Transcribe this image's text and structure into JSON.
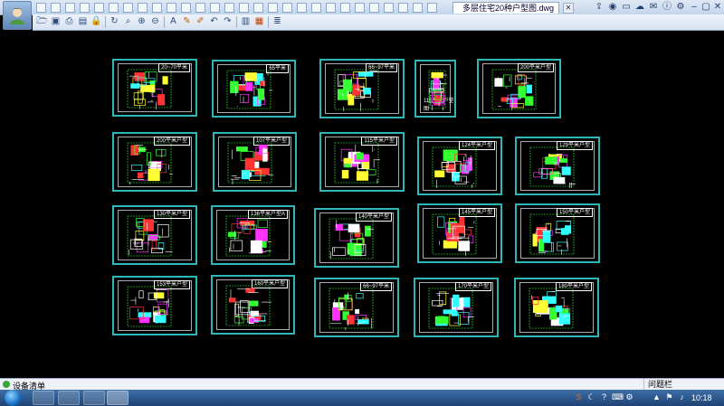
{
  "app": {
    "document_tab": "多层住宅20种户型图.dwg",
    "status_label": "设备清单",
    "status_right": "问题栏",
    "clock": "10:18"
  },
  "colors": {
    "sheet_border": "#2fb7b7",
    "canvas_bg": "#000000",
    "plan_colors": [
      "#ff33ff",
      "#33ff33",
      "#ffff33",
      "#ffffff",
      "#33ffff",
      "#ff3333"
    ]
  },
  "toolbar_icons": [
    "open-icon",
    "save-icon",
    "print-icon",
    "print-preview-icon",
    "lock-icon",
    "refresh-icon",
    "zoom-window-icon",
    "zoom-in-icon",
    "zoom-out-icon",
    "text-icon",
    "pencil-icon",
    "marker-icon",
    "undo-icon",
    "redo-icon",
    "layout-icon",
    "palette-icon",
    "layers-icon"
  ],
  "sheets": [
    {
      "label": "20~70平米"
    },
    {
      "label": "65平米"
    },
    {
      "label": "66~97平米"
    },
    {
      "label": "",
      "bottom_label": "115平米户型图"
    },
    {
      "label": "200平米户型"
    },
    {
      "label": "200平米户型"
    },
    {
      "label": "107平米户型"
    },
    {
      "label": "115平米户型"
    },
    {
      "label": "124平米户型"
    },
    {
      "label": "129平米户型"
    },
    {
      "label": "130平米户型"
    },
    {
      "label": "136平米户型A"
    },
    {
      "label": "140平米户型"
    },
    {
      "label": "145平米户型"
    },
    {
      "label": "150平米户型"
    },
    {
      "label": "153平米户型"
    },
    {
      "label": "160平米户型"
    },
    {
      "label": "66~97平米"
    },
    {
      "label": "170平米户型"
    },
    {
      "label": "180平米户型"
    }
  ]
}
